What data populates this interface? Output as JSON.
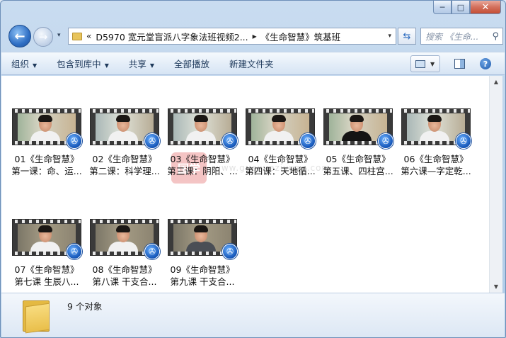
{
  "window": {
    "minimize_label": "─",
    "maximize_label": "□",
    "close_label": "✕"
  },
  "nav": {
    "back_glyph": "←",
    "forward_glyph": "→",
    "history_glyph": "▾",
    "breadcrumb_overflow": "«",
    "breadcrumb_1": "D5970 宽元堂盲派八字象法班视频2...",
    "breadcrumb_sep": "▸",
    "breadcrumb_2": "《生命智慧》筑基班",
    "address_dropdown": "▾",
    "refresh_glyph": "⇆",
    "search_placeholder": "搜索 《生命...",
    "search_glyph": "⚲"
  },
  "commands": {
    "organize": "组织",
    "include_in_library": "包含到库中",
    "share": "共享",
    "play_all": "全部播放",
    "new_folder": "新建文件夹",
    "caret": "▼",
    "help": "?"
  },
  "watermark": {
    "logo_text": "国学",
    "site": "www.guoxueziyuan.com"
  },
  "files": [
    {
      "title": "01《生命智慧》",
      "subtitle": "第一课：命、运..."
    },
    {
      "title": "02《生命智慧》",
      "subtitle": "第二课：科学理..."
    },
    {
      "title": "03《生命智慧》",
      "subtitle": "第三课：阴阳、..."
    },
    {
      "title": "04《生命智慧》",
      "subtitle": "第四课：天地循..."
    },
    {
      "title": "05《生命智慧》",
      "subtitle": "第五课、四柱宫..."
    },
    {
      "title": "06《生命智慧》",
      "subtitle": "第六课—字定乾..."
    },
    {
      "title": "07《生命智慧》",
      "subtitle": "第七课 生辰八..."
    },
    {
      "title": "08《生命智慧》",
      "subtitle": "第八课 干支合..."
    },
    {
      "title": "09《生命智慧》",
      "subtitle": "第九课 干支合..."
    }
  ],
  "media_badge_glyph": "✇",
  "status": {
    "count": "9 个对象"
  },
  "scroll": {
    "up": "▲",
    "down": "▼"
  }
}
